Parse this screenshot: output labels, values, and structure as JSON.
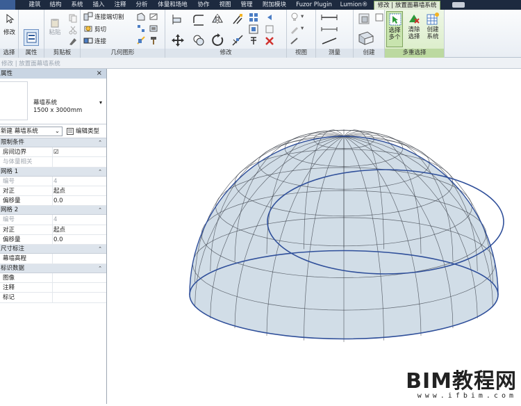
{
  "ribbon_tabs": [
    "建筑",
    "结构",
    "系统",
    "插入",
    "注释",
    "分析",
    "体量和场地",
    "协作",
    "视图",
    "管理",
    "附加模块",
    "Fuzor Plugin",
    "Lumion®",
    "修改 | 放置面幕墙系统"
  ],
  "ribbon": {
    "modify_label": "修改",
    "select_panel": "选择",
    "properties_label": "属性",
    "properties_panel": "属性",
    "paste_label": "粘贴",
    "clipboard_panel": "剪贴板",
    "join_cut_label": "连接端切割",
    "cut_label": "剪切",
    "connect_label": "连接",
    "geometry_panel": "几何图形",
    "modify_panel": "修改",
    "view_panel": "视图",
    "measure_panel": "测量",
    "create_panel": "创建",
    "select_multiple_label": "选择\n多个",
    "clear_selection_label": "清除\n选择",
    "create_system_label": "创建\n系统",
    "multi_select_panel": "多重选择"
  },
  "options_bar": "修改 | 放置面幕墙系统",
  "properties": {
    "title": "属性",
    "type_name": "幕墙系统",
    "type_size": "1500 x 3000mm",
    "instance_dropdown": "新建 幕墙系统",
    "edit_type": "编辑类型",
    "groups": [
      {
        "name": "限制条件",
        "rows": [
          {
            "key": "房间边界",
            "value": "☑",
            "dim": false
          },
          {
            "key": "与体量相关",
            "value": "",
            "dim": true
          }
        ]
      },
      {
        "name": "网格 1",
        "rows": [
          {
            "key": "编号",
            "value": "4",
            "dim": true
          },
          {
            "key": "对正",
            "value": "起点",
            "dim": false
          },
          {
            "key": "偏移量",
            "value": "0.0",
            "dim": false
          }
        ]
      },
      {
        "name": "网格 2",
        "rows": [
          {
            "key": "编号",
            "value": "4",
            "dim": true
          },
          {
            "key": "对正",
            "value": "起点",
            "dim": false
          },
          {
            "key": "偏移量",
            "value": "0.0",
            "dim": false
          }
        ]
      },
      {
        "name": "尺寸标注",
        "rows": [
          {
            "key": "幕墙高程",
            "value": "",
            "dim": false
          }
        ]
      },
      {
        "name": "标识数据",
        "rows": [
          {
            "key": "图像",
            "value": "",
            "dim": false
          },
          {
            "key": "注释",
            "value": "",
            "dim": false
          },
          {
            "key": "标记",
            "value": "",
            "dim": false
          }
        ]
      }
    ]
  },
  "watermark": {
    "main": "BIM教程网",
    "sub": "www.ifbim.com"
  },
  "colors": {
    "accent": "#7fa35f",
    "dome_fill": "#c9d7e3",
    "dome_edge": "#2f4f9a"
  }
}
